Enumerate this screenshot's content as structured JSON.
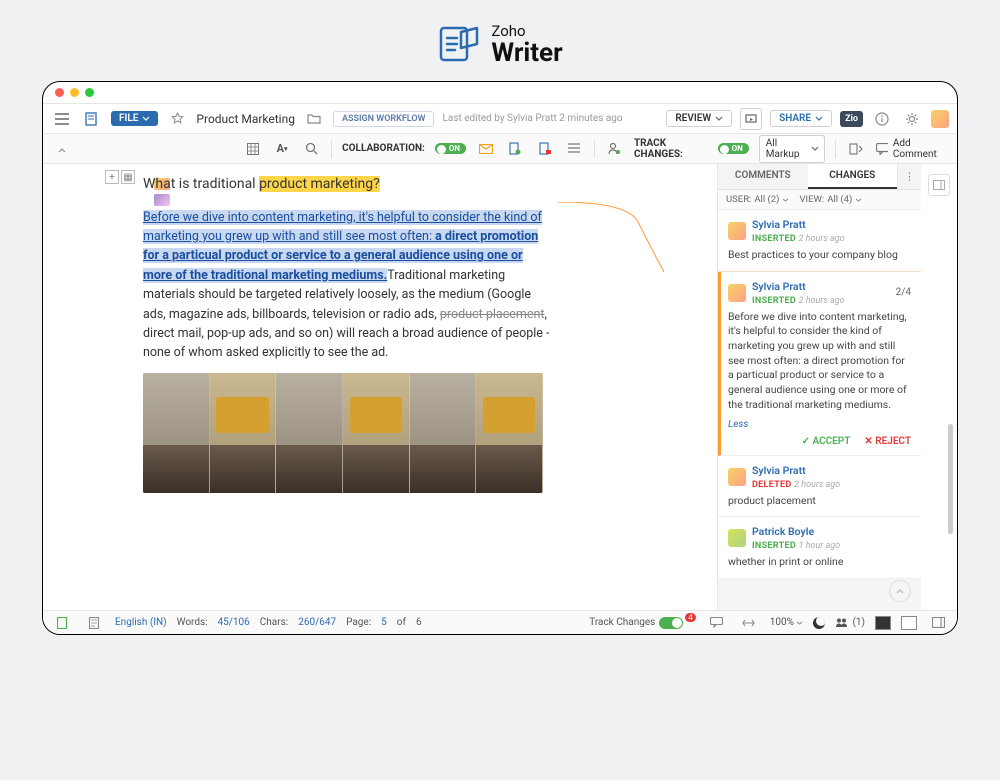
{
  "brand": {
    "company": "Zoho",
    "product": "Writer"
  },
  "topbar": {
    "file_label": "FILE",
    "doc_title": "Product Marketing",
    "assign_label": "ASSIGN WORKFLOW",
    "last_edited": "Last edited by Sylvia Pratt 2 minutes ago",
    "review_label": "REVIEW",
    "share_label": "SHARE",
    "zio_label": "Zio"
  },
  "toolbar": {
    "collab_label": "COLLABORATION:",
    "collab_state": "ON",
    "track_label": "TRACK CHANGES:",
    "track_state": "ON",
    "markup_label": "All Markup",
    "add_comment_label": "Add Comment"
  },
  "doc": {
    "heading_prefix": "What is traditional ",
    "heading_highlight": "product marketing?",
    "selected_intro": "Before we dive into content marketing, it's helpful to consider the kind of marketing you grew up with and still see most often: ",
    "selected_bold": "a direct promotion for a particual product or service to a general audience using one or more of the traditional marketing mediums.",
    "body_after_1": "Traditional marketing materials should be targeted relatively loosely, as the medium (Google ads, magazine ads, billboards, television or radio ads, ",
    "strike": "product placement",
    "body_after_2": ", direct mail, pop-up ads, and so on) will reach a broad audience of people - none of whom asked explicitly to see the ad."
  },
  "panel": {
    "tab_comments": "COMMENTS",
    "tab_changes": "CHANGES",
    "filter_user_label": "USER:",
    "filter_user_value": "All (2)",
    "filter_view_label": "VIEW:",
    "filter_view_value": "All (4)",
    "less_label": "Less",
    "accept_label": "ACCEPT",
    "reject_label": "REJECT",
    "items": [
      {
        "author": "Sylvia Pratt",
        "action": "INSERTED",
        "time": "2 hours ago",
        "body": "Best practices to your company blog"
      },
      {
        "author": "Sylvia Pratt",
        "action": "INSERTED",
        "time": "2 hours ago",
        "counter": "2/4",
        "body": "Before we dive into content marketing, it's helpful to consider the kind of marketing you grew up with and still see most often: a direct promotion for a particual product or service to a general audience using one or more of the traditional marketing mediums."
      },
      {
        "author": "Sylvia Pratt",
        "action": "DELETED",
        "time": "2 hours ago",
        "body": "product placement"
      },
      {
        "author": "Patrick Boyle",
        "action": "INSERTED",
        "time": "1 hour ago",
        "body": "whether in print or online"
      }
    ]
  },
  "status": {
    "language": "English (IN)",
    "words_label": "Words:",
    "words_value": "45/106",
    "chars_label": "Chars:",
    "chars_value": "260/647",
    "page_label": "Page:",
    "page_current": "5",
    "page_sep": "of",
    "page_total": "6",
    "track_changes_label": "Track Changes",
    "notif_count": "4",
    "zoom": "100%",
    "collab_count": "(1)"
  }
}
